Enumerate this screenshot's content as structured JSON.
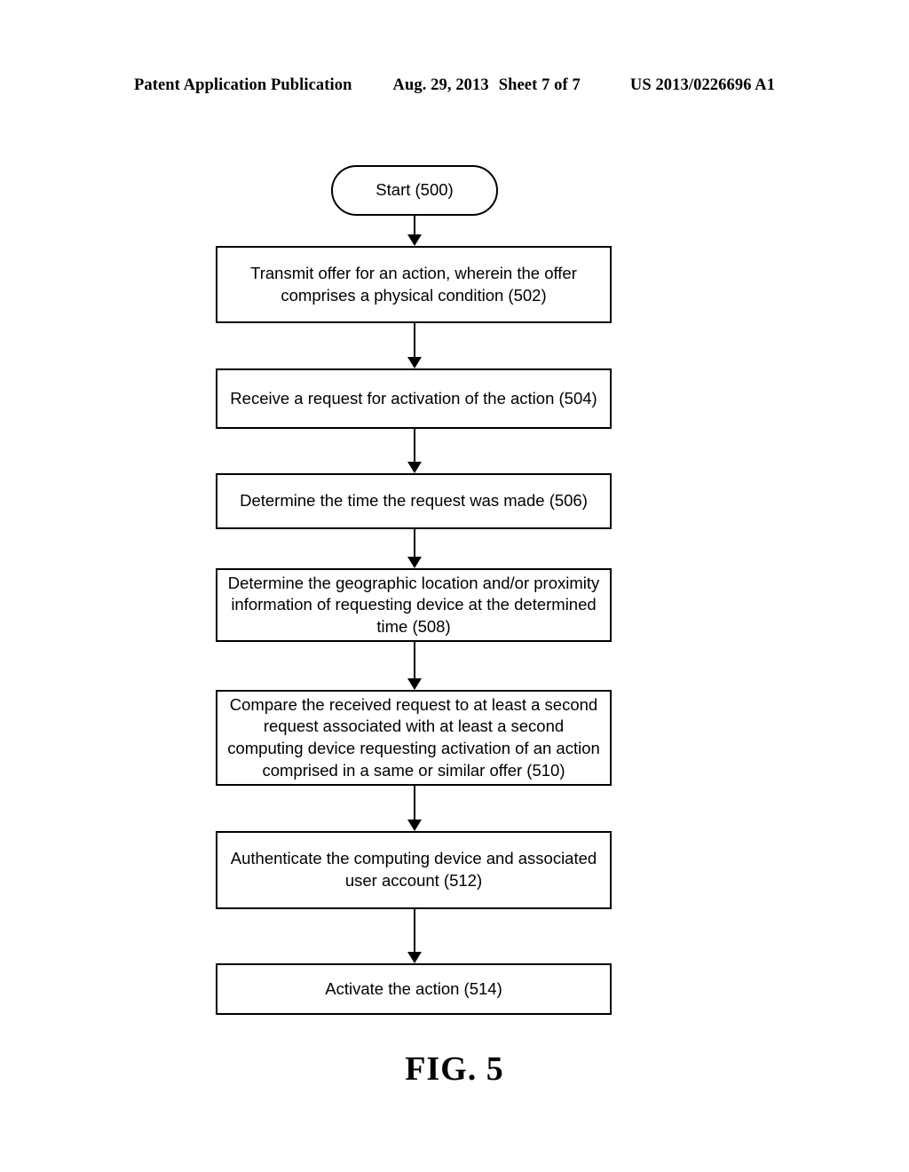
{
  "header": {
    "publication": "Patent Application Publication",
    "date": "Aug. 29, 2013",
    "sheet": "Sheet 7 of 7",
    "patent_number": "US 2013/0226696 A1"
  },
  "figure": {
    "caption": "FIG. 5",
    "nodes": [
      {
        "id": "500",
        "shape": "terminal",
        "text": "Start (500)"
      },
      {
        "id": "502",
        "shape": "process",
        "text": "Transmit offer for an action, wherein the offer comprises a physical condition (502)"
      },
      {
        "id": "504",
        "shape": "process",
        "text": "Receive a request for activation of the action (504)"
      },
      {
        "id": "506",
        "shape": "process",
        "text": "Determine the time the request was made (506)"
      },
      {
        "id": "508",
        "shape": "process",
        "text": "Determine the geographic location and/or proximity information of requesting device at the determined time (508)"
      },
      {
        "id": "510",
        "shape": "process",
        "text": "Compare the received request to at least a second request associated with at least a second computing device requesting activation of an action comprised in a same or similar offer (510)"
      },
      {
        "id": "512",
        "shape": "process",
        "text": "Authenticate the computing device and associated user account (512)"
      },
      {
        "id": "514",
        "shape": "process",
        "text": "Activate the action (514)"
      }
    ],
    "edges": [
      {
        "from": "500",
        "to": "502"
      },
      {
        "from": "502",
        "to": "504"
      },
      {
        "from": "504",
        "to": "506"
      },
      {
        "from": "506",
        "to": "508"
      },
      {
        "from": "508",
        "to": "510"
      },
      {
        "from": "510",
        "to": "512"
      },
      {
        "from": "512",
        "to": "514"
      }
    ]
  },
  "colors": {
    "ink": "#000000",
    "paper": "#ffffff"
  }
}
